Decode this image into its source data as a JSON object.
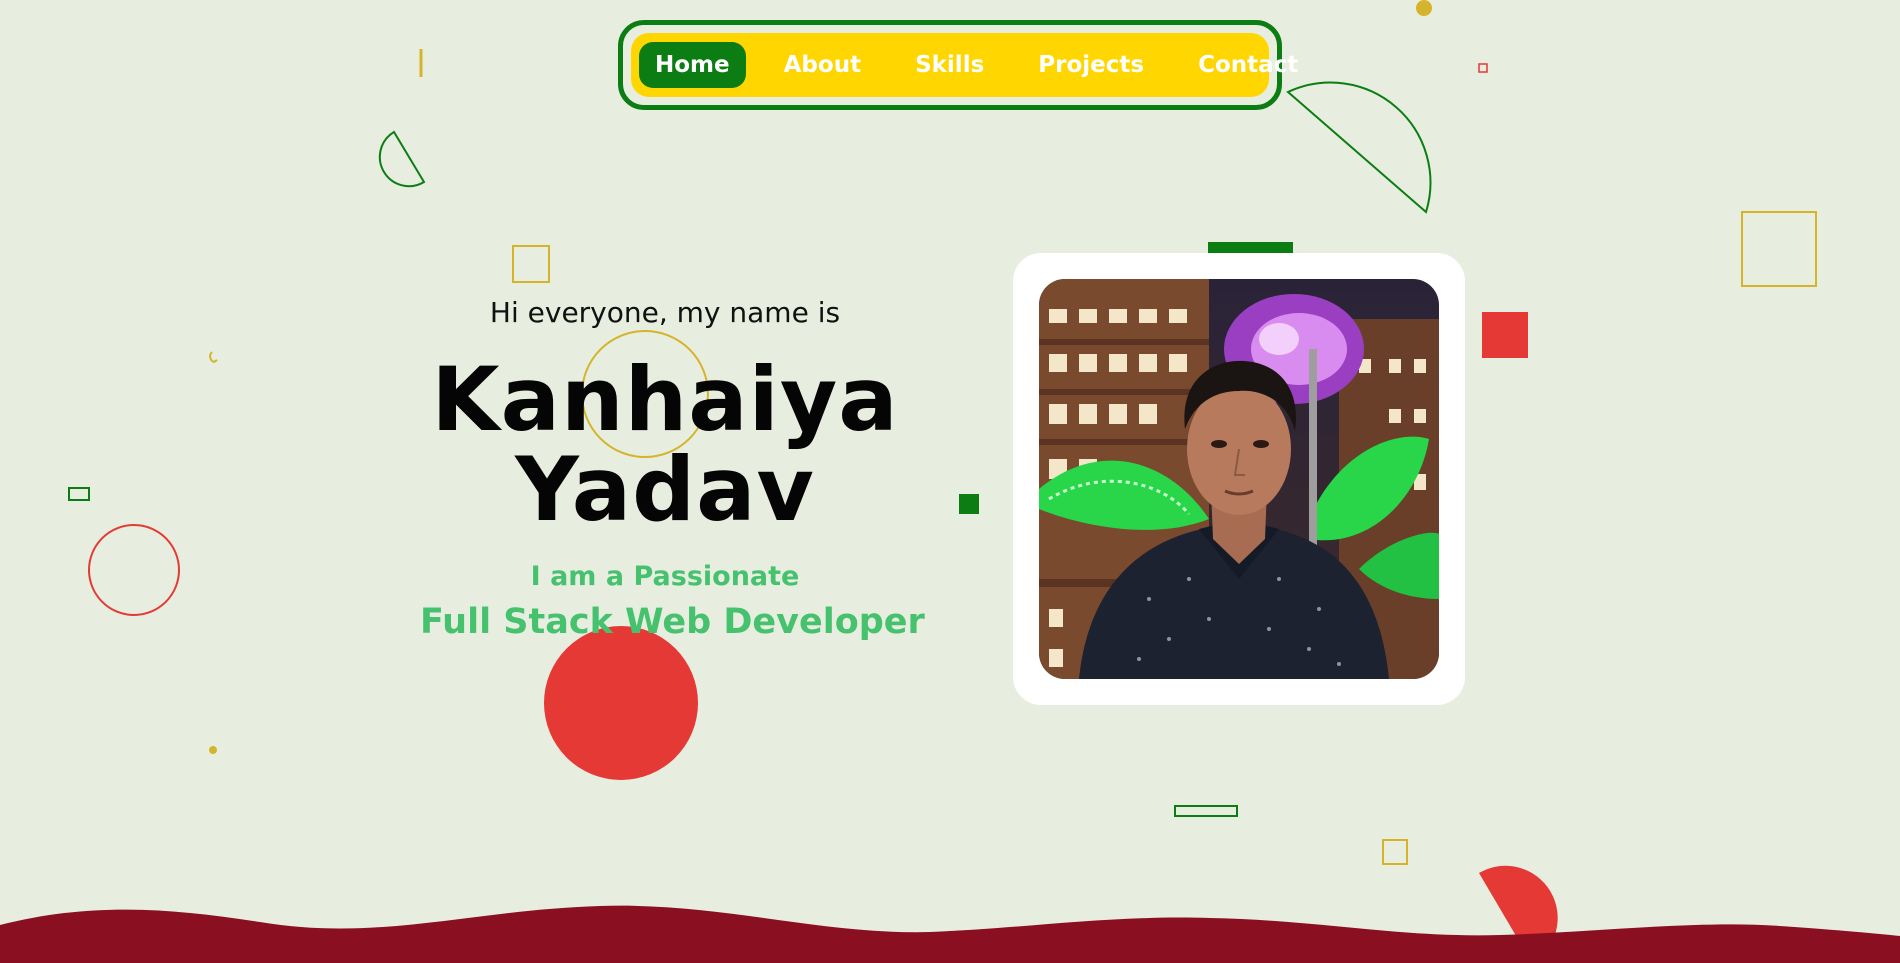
{
  "nav": {
    "items": [
      {
        "label": "Home",
        "active": true
      },
      {
        "label": "About",
        "active": false
      },
      {
        "label": "Skills",
        "active": false
      },
      {
        "label": "Projects",
        "active": false
      },
      {
        "label": "Contact",
        "active": false
      }
    ]
  },
  "hero": {
    "greeting": "Hi everyone, my name is",
    "name_first": "Kanhaiya",
    "name_last": "Yadav",
    "tagline_1": "I am a Passionate",
    "tagline_2": "Full Stack Web Developer"
  },
  "profile_photo": {
    "icon": "profile-photo"
  },
  "colors": {
    "background": "#e7eedf",
    "green": "#0b7d13",
    "yellow": "#ffd600",
    "red": "#e53935",
    "accent_text": "#46c26f",
    "wave": "#8a1021"
  }
}
